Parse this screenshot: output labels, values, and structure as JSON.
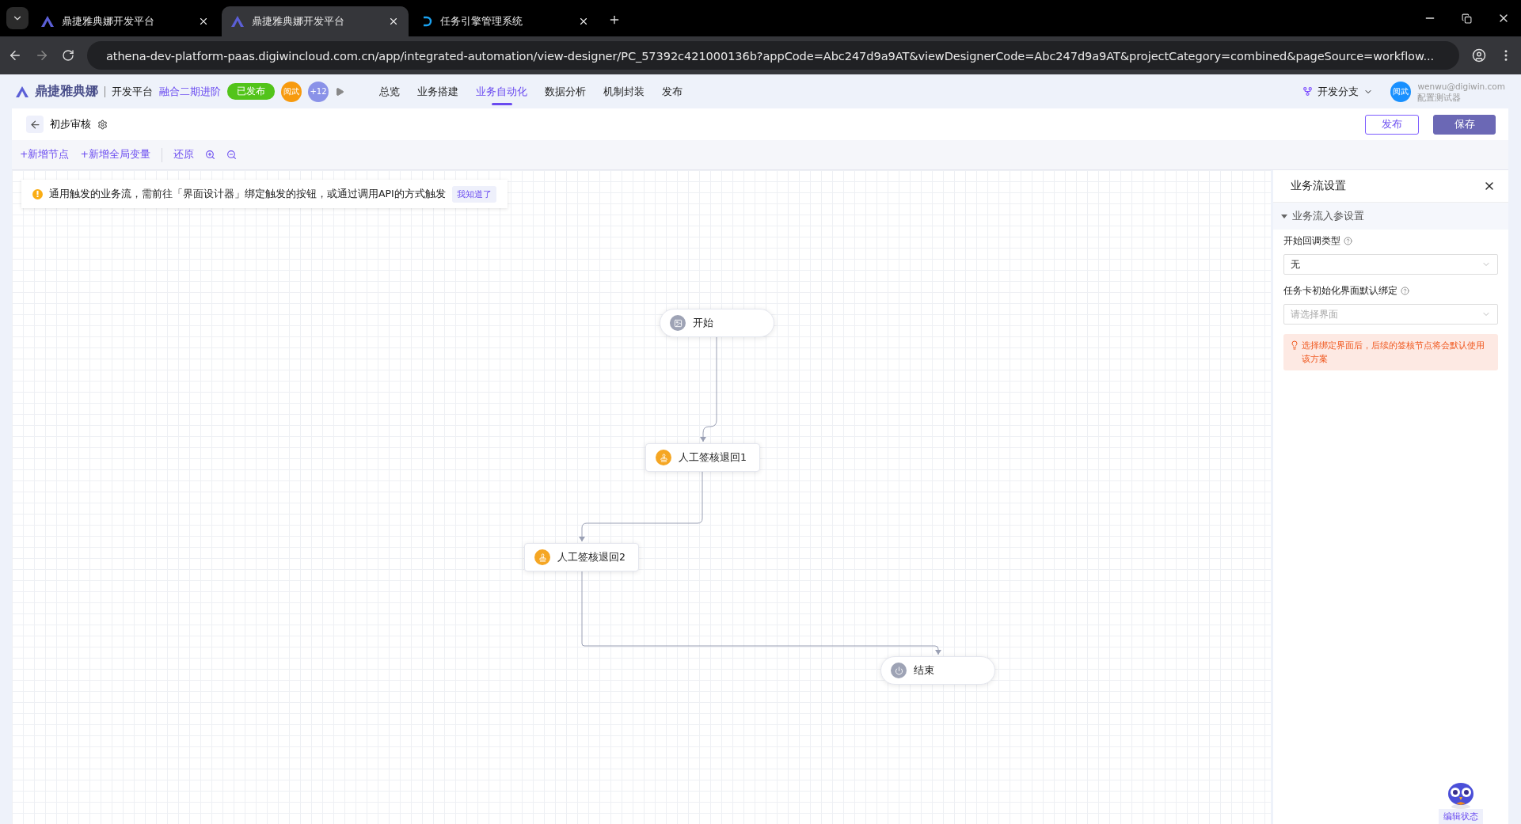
{
  "browser": {
    "tabs": [
      {
        "title": "鼎捷雅典娜开发平台",
        "selected": false
      },
      {
        "title": "鼎捷雅典娜开发平台",
        "selected": true
      },
      {
        "title": "任务引擎管理系统",
        "selected": false
      }
    ],
    "url": "athena-dev-platform-paas.digiwincloud.com.cn/app/integrated-automation/view-designer/PC_57392c421000136b?appCode=Abc247d9a9AT&viewDesignerCode=Abc247d9a9AT&projectCategory=combined&pageSource=workflow..."
  },
  "header": {
    "brand": "鼎捷雅典娜",
    "platform": "开发平台",
    "project": "融合二期进阶",
    "status": "已发布",
    "members": [
      "阅武",
      "+12"
    ],
    "nav": [
      {
        "label": "总览",
        "selected": false
      },
      {
        "label": "业务搭建",
        "selected": false
      },
      {
        "label": "业务自动化",
        "selected": true
      },
      {
        "label": "数据分析",
        "selected": false
      },
      {
        "label": "机制封装",
        "selected": false
      },
      {
        "label": "发布",
        "selected": false
      }
    ],
    "branch": "开发分支",
    "user": {
      "avatar": "阅武",
      "email": "wenwu@digiwin.com",
      "role": "配置测试器"
    }
  },
  "page": {
    "title": "初步审核",
    "buttons": [
      {
        "label": "发布",
        "kind": "outline"
      },
      {
        "label": "保存",
        "kind": "primary"
      }
    ]
  },
  "toolbar": [
    {
      "label": "+新增节点",
      "kind": "text"
    },
    {
      "label": "+新增全局变量",
      "kind": "text"
    },
    {
      "label": "还原",
      "kind": "text"
    },
    {
      "kind": "zoom-in"
    },
    {
      "kind": "zoom-out"
    }
  ],
  "banner": {
    "text": "通用触发的业务流，需前往「界面设计器」绑定触发的按钮，或通过调用API的方式触发",
    "action": "我知道了"
  },
  "nodes": [
    {
      "label": "开始",
      "kind": "start"
    },
    {
      "label": "人工签核退回1",
      "kind": "approval"
    },
    {
      "label": "人工签核退回2",
      "kind": "approval"
    },
    {
      "label": "结束",
      "kind": "end"
    }
  ],
  "panel": {
    "title": "业务流设置",
    "section": {
      "title": "业务流入参设置",
      "expanded": true
    },
    "fields": [
      {
        "label": "开始回调类型",
        "value": "无"
      },
      {
        "label": "任务卡初始化界面默认绑定",
        "placeholder": "请选择界面"
      }
    ],
    "tip": "选择绑定界面后，后续的签核节点将会默认使用该方案"
  },
  "assistant": {
    "label": "编辑状态"
  }
}
